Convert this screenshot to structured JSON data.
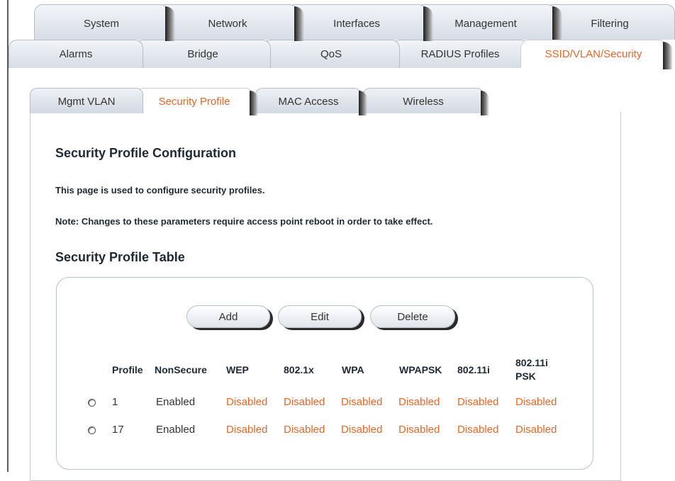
{
  "main_tabs": [
    "System",
    "Network",
    "Interfaces",
    "Management",
    "Filtering"
  ],
  "sub_tabs": [
    "Alarms",
    "Bridge",
    "QoS",
    "RADIUS Profiles",
    "SSID/VLAN/Security"
  ],
  "active_sub_tab": "SSID/VLAN/Security",
  "section_tabs": [
    "Mgmt VLAN",
    "Security Profile",
    "MAC Access",
    "Wireless"
  ],
  "active_section_tab": "Security Profile",
  "page": {
    "title": "Security Profile Configuration",
    "description": "This page is used to configure security profiles.",
    "note": "Note: Changes to these parameters require access point reboot in order to take effect.",
    "table_title": "Security Profile Table"
  },
  "buttons": {
    "add": "Add",
    "edit": "Edit",
    "delete": "Delete"
  },
  "table": {
    "headers": [
      "Profile",
      "NonSecure",
      "WEP",
      "802.1x",
      "WPA",
      "WPAPSK",
      "802.11i",
      "802.11i PSK"
    ],
    "rows": [
      [
        "1",
        "Enabled",
        "Disabled",
        "Disabled",
        "Disabled",
        "Disabled",
        "Disabled",
        "Disabled"
      ],
      [
        "17",
        "Enabled",
        "Disabled",
        "Disabled",
        "Disabled",
        "Disabled",
        "Disabled",
        "Disabled"
      ]
    ]
  },
  "colors": {
    "active_tab_text": "#e8662a",
    "disabled_text": "#e8662a",
    "heading_text": "#1f2933"
  }
}
